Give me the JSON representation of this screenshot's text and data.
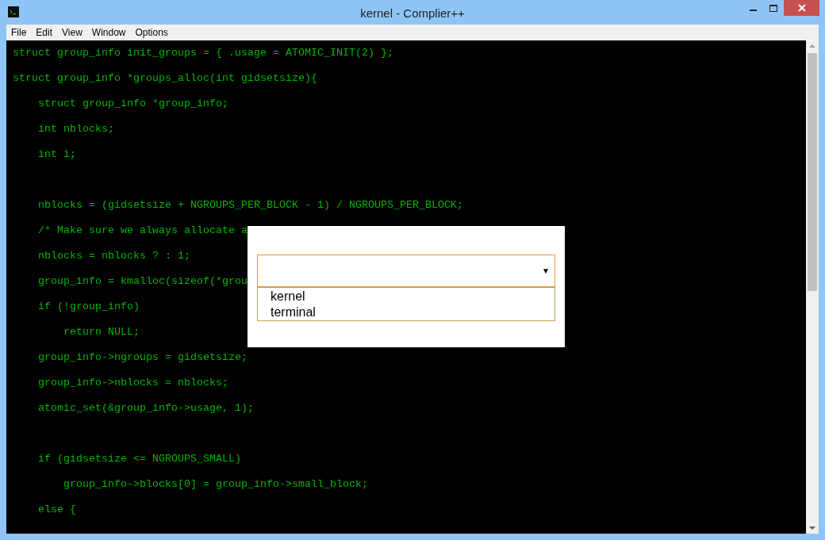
{
  "window": {
    "title": "kernel - Complier++"
  },
  "menu": [
    "File",
    "Edit",
    "View",
    "Window",
    "Options"
  ],
  "editor": {
    "lines": [
      {
        "kind": "code",
        "text": "struct group_info init_groups = { .usage = ATOMIC_INIT(2) };"
      },
      {
        "kind": "code",
        "text": "struct group_info *groups_alloc(int gidsetsize){"
      },
      {
        "kind": "code",
        "text": "    struct group_info *group_info;"
      },
      {
        "kind": "code",
        "text": "    int nblocks;"
      },
      {
        "kind": "code",
        "text": "    int i;"
      },
      {
        "kind": "blank"
      },
      {
        "kind": "code",
        "text": "    nblocks = (gidsetsize + NGROUPS_PER_BLOCK - 1) / NGROUPS_PER_BLOCK;"
      },
      {
        "kind": "code",
        "text": "    /* Make sure we always allocate a"
      },
      {
        "kind": "code",
        "text": "    nblocks = nblocks ? : 1;"
      },
      {
        "kind": "code",
        "text": "    group_info = kmalloc(sizeof(*grou"
      },
      {
        "kind": "code",
        "text": "    if (!group_info)"
      },
      {
        "kind": "code",
        "text": "        return NULL;"
      },
      {
        "kind": "code",
        "text": "    group_info->ngroups = gidsetsize;"
      },
      {
        "kind": "code",
        "text": "    group_info->nblocks = nblocks;"
      },
      {
        "kind": "code",
        "text": "    atomic_set(&group_info->usage, 1);"
      },
      {
        "kind": "blank"
      },
      {
        "kind": "code",
        "text": "    if (gidsetsize <= NGROUPS_SMALL)"
      },
      {
        "kind": "code",
        "text": "        group_info->blocks[0] = group_info->small_block;"
      },
      {
        "kind": "code",
        "text": "    else {"
      }
    ]
  },
  "dialog": {
    "select": {
      "caret": "▼",
      "expanded": true,
      "options": [
        "kernel",
        "terminal"
      ]
    }
  }
}
